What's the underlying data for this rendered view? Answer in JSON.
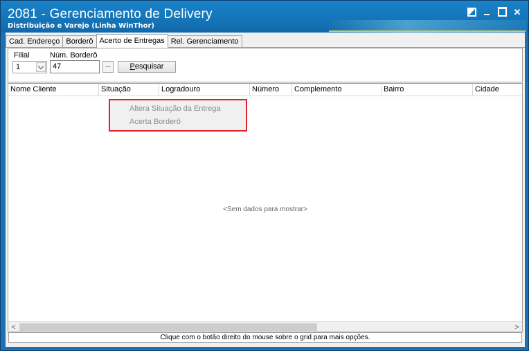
{
  "window": {
    "title": "2081 - Gerenciamento de Delivery",
    "subtitle": "Distribuição e Varejo (Linha WinThor)"
  },
  "tabs": [
    {
      "label": "Cad. Endereço"
    },
    {
      "label": "Borderô"
    },
    {
      "label": "Acerto de Entregas",
      "active": true
    },
    {
      "label": "Rel. Gerenciamento"
    }
  ],
  "filters": {
    "filial_label": "Filial",
    "filial_value": "1",
    "bordero_label": "Núm. Borderô",
    "bordero_value": "47",
    "ellipsis_label": "...",
    "search_label_first": "P",
    "search_label_rest": "esquisar"
  },
  "grid": {
    "columns": [
      "Nome Cliente",
      "Situação",
      "Logradouro",
      "Número",
      "Complemento",
      "Bairro",
      "Cidade"
    ],
    "empty_text": "<Sem dados para mostrar>"
  },
  "context_menu": {
    "items": [
      "Altera Situação da Entrega",
      "Acerta Borderô"
    ]
  },
  "status_bar": {
    "text": "Clique com o botão direito do mouse sobre o grid para mais opções."
  },
  "icons": {
    "restore": "restore-icon",
    "minimize": "minimize-icon",
    "maximize": "maximize-icon",
    "close": "close-icon",
    "dropdown": "chevron-down-icon",
    "scroll_left": "chevron-left-icon",
    "scroll_right": "chevron-right-icon"
  },
  "colors": {
    "titlebar": "#1474b8",
    "highlight_border": "#e0242a"
  }
}
